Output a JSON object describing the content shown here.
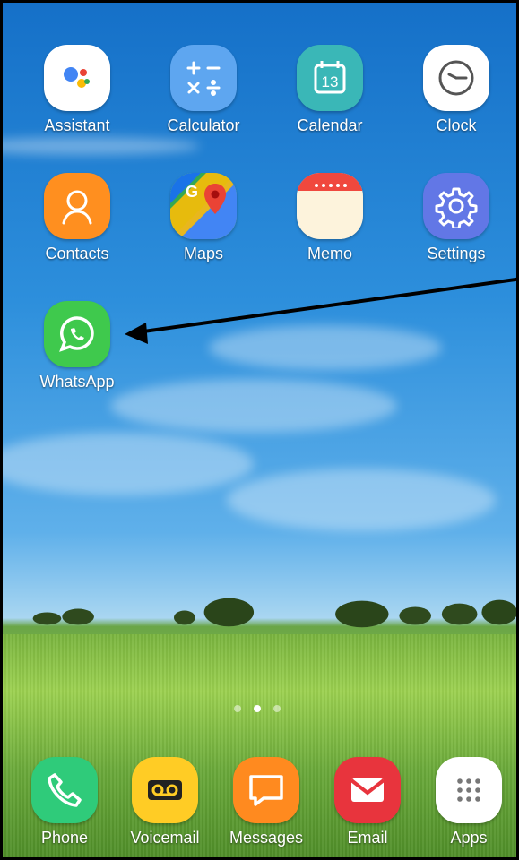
{
  "apps_row1": [
    "Assistant",
    "Calculator",
    "Calendar",
    "Clock"
  ],
  "apps_row2": [
    "Contacts",
    "Maps",
    "Memo",
    "Settings"
  ],
  "apps_row3": [
    "WhatsApp"
  ],
  "dock": [
    "Phone",
    "Voicemail",
    "Messages",
    "Email",
    "Apps"
  ],
  "calendar_day": "13",
  "maps_letter": "G",
  "colors": {
    "assistant_bg": "#ffffff",
    "calculator_bg": "#5ea6f0",
    "calendar_bg": "#3ab7b7",
    "clock_bg": "#ffffff",
    "contacts_bg": "#ff8f1f",
    "settings_bg": "#6277e6",
    "whatsapp_bg": "#3fc94d",
    "phone_bg": "#2fcb7a",
    "voicemail_bg": "#ffcc25",
    "messages_bg": "#ff8a1f",
    "email_bg": "#e8343d",
    "apps_bg": "#ffffff"
  },
  "page_indicator": {
    "pages": 3,
    "active": 1
  }
}
